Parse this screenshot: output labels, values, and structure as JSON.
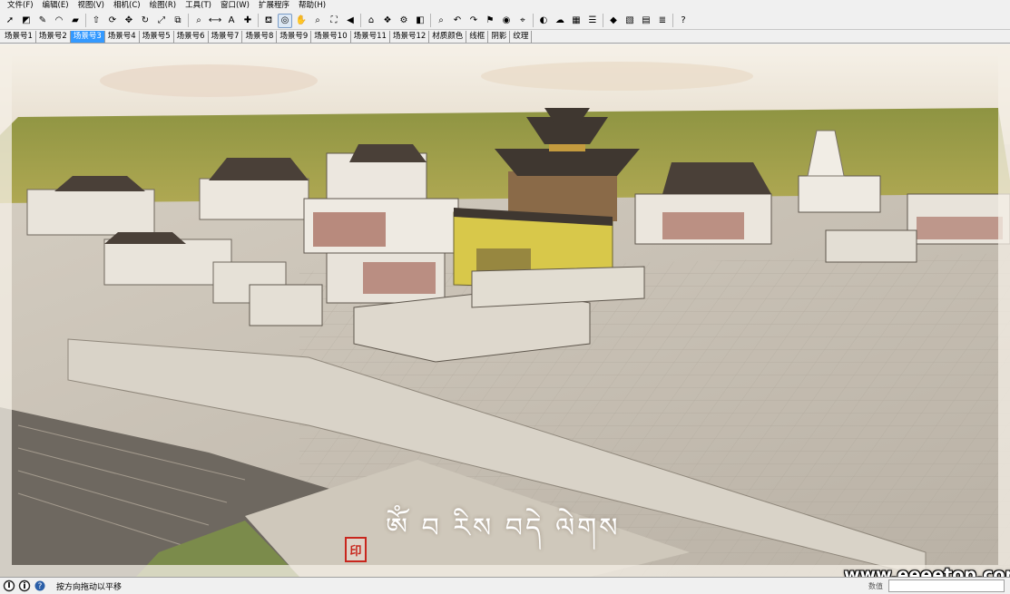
{
  "menu": [
    "文件(F)",
    "编辑(E)",
    "视图(V)",
    "相机(C)",
    "绘图(R)",
    "工具(T)",
    "窗口(W)",
    "扩展程序",
    "帮助(H)"
  ],
  "toolbar": {
    "tools": [
      {
        "name": "select-icon",
        "glyph": "➚"
      },
      {
        "name": "eraser-icon",
        "glyph": "◩"
      },
      {
        "name": "pencil-icon",
        "glyph": "✎"
      },
      {
        "name": "arc-icon",
        "glyph": "◠"
      },
      {
        "name": "rectangle-icon",
        "glyph": "▰"
      },
      {
        "name": "push-pull-icon",
        "glyph": "⇧"
      },
      {
        "name": "follow-me-icon",
        "glyph": "⟳"
      },
      {
        "name": "move-icon",
        "glyph": "✥"
      },
      {
        "name": "rotate-icon",
        "glyph": "↻"
      },
      {
        "name": "scale-icon",
        "glyph": "⤢"
      },
      {
        "name": "offset-icon",
        "glyph": "⧉"
      },
      {
        "name": "tape-measure-icon",
        "glyph": "⌕"
      },
      {
        "name": "dimension-icon",
        "glyph": "⟷"
      },
      {
        "name": "text-icon",
        "glyph": "A"
      },
      {
        "name": "axes-icon",
        "glyph": "✚"
      },
      {
        "name": "paint-bucket-icon",
        "glyph": "⛾"
      },
      {
        "name": "orbit-icon",
        "glyph": "◎"
      },
      {
        "name": "pan-icon",
        "glyph": "✋"
      },
      {
        "name": "zoom-icon",
        "glyph": "⌕"
      },
      {
        "name": "zoom-extents-icon",
        "glyph": "⛶"
      },
      {
        "name": "previous-view-icon",
        "glyph": "◀"
      },
      {
        "name": "warehouse-icon",
        "glyph": "⌂"
      },
      {
        "name": "components-icon",
        "glyph": "❖"
      },
      {
        "name": "extensions-icon",
        "glyph": "⚙"
      },
      {
        "name": "section-plane-icon",
        "glyph": "◧"
      },
      {
        "name": "magnifier-icon",
        "glyph": "⌕"
      },
      {
        "name": "undo-icon",
        "glyph": "↶"
      },
      {
        "name": "redo-icon",
        "glyph": "↷"
      },
      {
        "name": "walk-icon",
        "glyph": "⚑"
      },
      {
        "name": "look-around-icon",
        "glyph": "◉"
      },
      {
        "name": "position-camera-icon",
        "glyph": "⌖"
      },
      {
        "name": "shadow-icon",
        "glyph": "◐"
      },
      {
        "name": "fog-icon",
        "glyph": "☁"
      },
      {
        "name": "sandbox-icon",
        "glyph": "▦"
      },
      {
        "name": "layer-icon",
        "glyph": "☰"
      },
      {
        "name": "material-icon",
        "glyph": "◆"
      },
      {
        "name": "style-icon",
        "glyph": "▧"
      },
      {
        "name": "scene-icon",
        "glyph": "▤"
      },
      {
        "name": "outliner-icon",
        "glyph": "≣"
      },
      {
        "name": "help-icon",
        "glyph": "?"
      }
    ]
  },
  "scene_tabs": [
    "场景号1",
    "场景号2",
    "场景号3",
    "场景号4",
    "场景号5",
    "场景号6",
    "场景号7",
    "场景号8",
    "场景号9",
    "场景号10",
    "场景号11",
    "场景号12",
    "材质颜色",
    "线框",
    "阴影",
    "纹理"
  ],
  "active_tab_index": 2,
  "viewport": {
    "title_overlay": "ༀ བ རིས བདེ ལེགས",
    "seal_text": "印",
    "watermark": "www.eeeetop.com"
  },
  "statusbar": {
    "message": "按方向拖动以平移",
    "measurements_label": "数值"
  },
  "colors": {
    "active_tab": "#3399ff",
    "sky": "#efe8dc",
    "grass": "#a8a64a",
    "temple_roof": "#4a4038",
    "yellow_building": "#d8c84a",
    "plaza": "#c9c2b6",
    "seal": "#c8261d"
  }
}
